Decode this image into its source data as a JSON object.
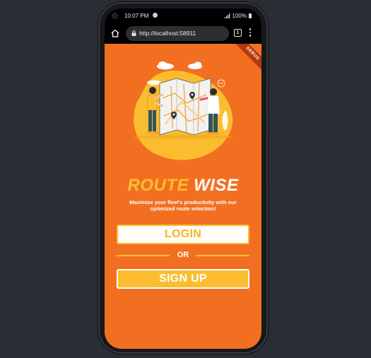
{
  "status_bar": {
    "time": "10:07 PM",
    "battery": "100%"
  },
  "browser": {
    "url": "http://localhost:58911",
    "tab_count": "1"
  },
  "app": {
    "debug_banner": "DEBUG",
    "title_part1": "ROUTE",
    "title_part2": "WISE",
    "subtitle": "Maximize your fleet's productivity with our optimized route selection!",
    "login_label": "LOGIN",
    "or_label": "OR",
    "signup_label": "SIGN UP"
  },
  "colors": {
    "background": "#f26f22",
    "accent": "#fbbd2f",
    "white": "#ffffff"
  }
}
